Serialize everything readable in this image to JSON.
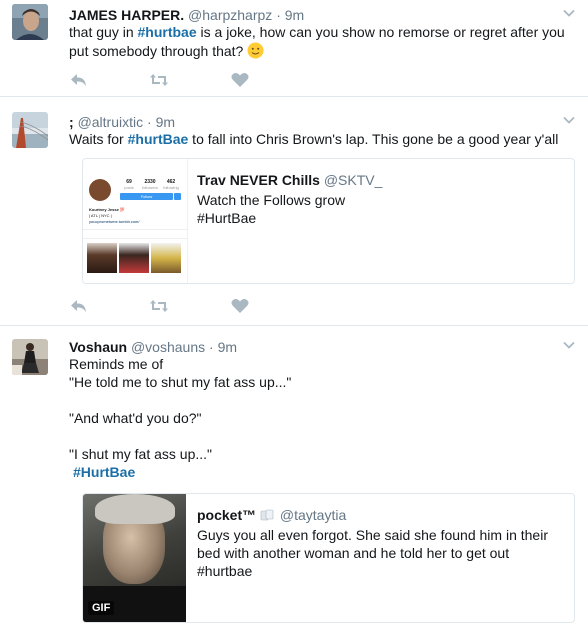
{
  "tweets": [
    {
      "name": "JAMES HARPER.",
      "handle": "@harpzharpz",
      "dot": "·",
      "time": "9m",
      "text_before": "that guy in ",
      "hashtag": "#hurtbae",
      "text_after": " is a joke, how can you show no remorse or regret after you put somebody through that?",
      "emoji": "slightly-smiling-face"
    },
    {
      "name": ";",
      "handle": "@altruixtic",
      "dot": "·",
      "time": "9m",
      "text_before": "Waits for ",
      "hashtag": "#hurtBae",
      "text_after": " to fall into Chris Brown's lap. This gone be a good year y'all",
      "quote": {
        "name": "Trav NEVER Chills",
        "handle": "@SKTV_",
        "line1": "Watch the Follows grow",
        "line2": "#HurtBae",
        "thumb": {
          "stat1_value": "69",
          "stat1_label": "posts",
          "stat2_value": "2330",
          "stat2_label": "followers",
          "stat3_value": "462",
          "stat3_label": "following",
          "follow": "Follow",
          "profile_name": "Kourtney Jesse 💯",
          "profile_line2": "| ATL | NYC |",
          "profile_link": "youcprometome.tumblr.com/"
        }
      }
    },
    {
      "name": "Voshaun",
      "handle": "@voshauns",
      "dot": "·",
      "time": "9m",
      "lines": [
        "Reminds me of",
        "\"He told me to shut my fat ass up...\"",
        "",
        "\"And what'd you do?\"",
        "",
        "\"I shut my fat ass up...\""
      ],
      "hashtag": "#HurtBae",
      "quote": {
        "name": "pocket™",
        "handle": "@taytaytia",
        "line1": "Guys you all even forgot. She said she found him in their",
        "line2": "bed with another woman and he told her to get out",
        "line3": "#hurtbae",
        "gif_label": "GIF"
      }
    }
  ],
  "icons": {
    "reply": "reply-icon",
    "retweet": "retweet-icon",
    "like": "heart-icon",
    "caret": "chevron-down-icon"
  },
  "colors": {
    "hashtag": "#1b6fa6",
    "muted": "#657786",
    "icon": "#aab8c2",
    "border": "#e1e8ed"
  }
}
